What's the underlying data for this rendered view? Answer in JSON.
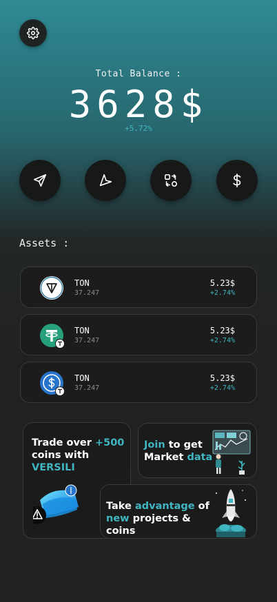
{
  "header": {
    "settings_icon": "gear-icon"
  },
  "balance": {
    "label": "Total Balance :",
    "value": "3628$",
    "change": "+5.72%"
  },
  "actions": [
    {
      "icon": "send-icon"
    },
    {
      "icon": "receive-icon"
    },
    {
      "icon": "swap-icon"
    },
    {
      "icon": "dollar-icon"
    }
  ],
  "assets": {
    "title": "Assets :",
    "items": [
      {
        "name": "TON",
        "amount": "37.247",
        "price": "5.23$",
        "change": "+2.74%",
        "icon": "ton-icon"
      },
      {
        "name": "TON",
        "amount": "37.247",
        "price": "5.23$",
        "change": "+2.74%",
        "icon": "tether-icon"
      },
      {
        "name": "TON",
        "amount": "37.247",
        "price": "5.23$",
        "change": "+2.74%",
        "icon": "usdc-icon"
      }
    ]
  },
  "promos": {
    "trade": {
      "line1_a": "Trade over ",
      "line1_b": "+500",
      "line2": "coins with",
      "line3": "VERSILI"
    },
    "join": {
      "a": "Join",
      "b": " to get",
      "c": "Market ",
      "d": "data"
    },
    "advantage": {
      "a": "Take ",
      "b": "advantage",
      "c": " of",
      "d": "new",
      "e": " projects & coins"
    }
  },
  "colors": {
    "accent": "#3fb6c2",
    "top_gradient": "#2f8a94",
    "background": "#222222"
  }
}
